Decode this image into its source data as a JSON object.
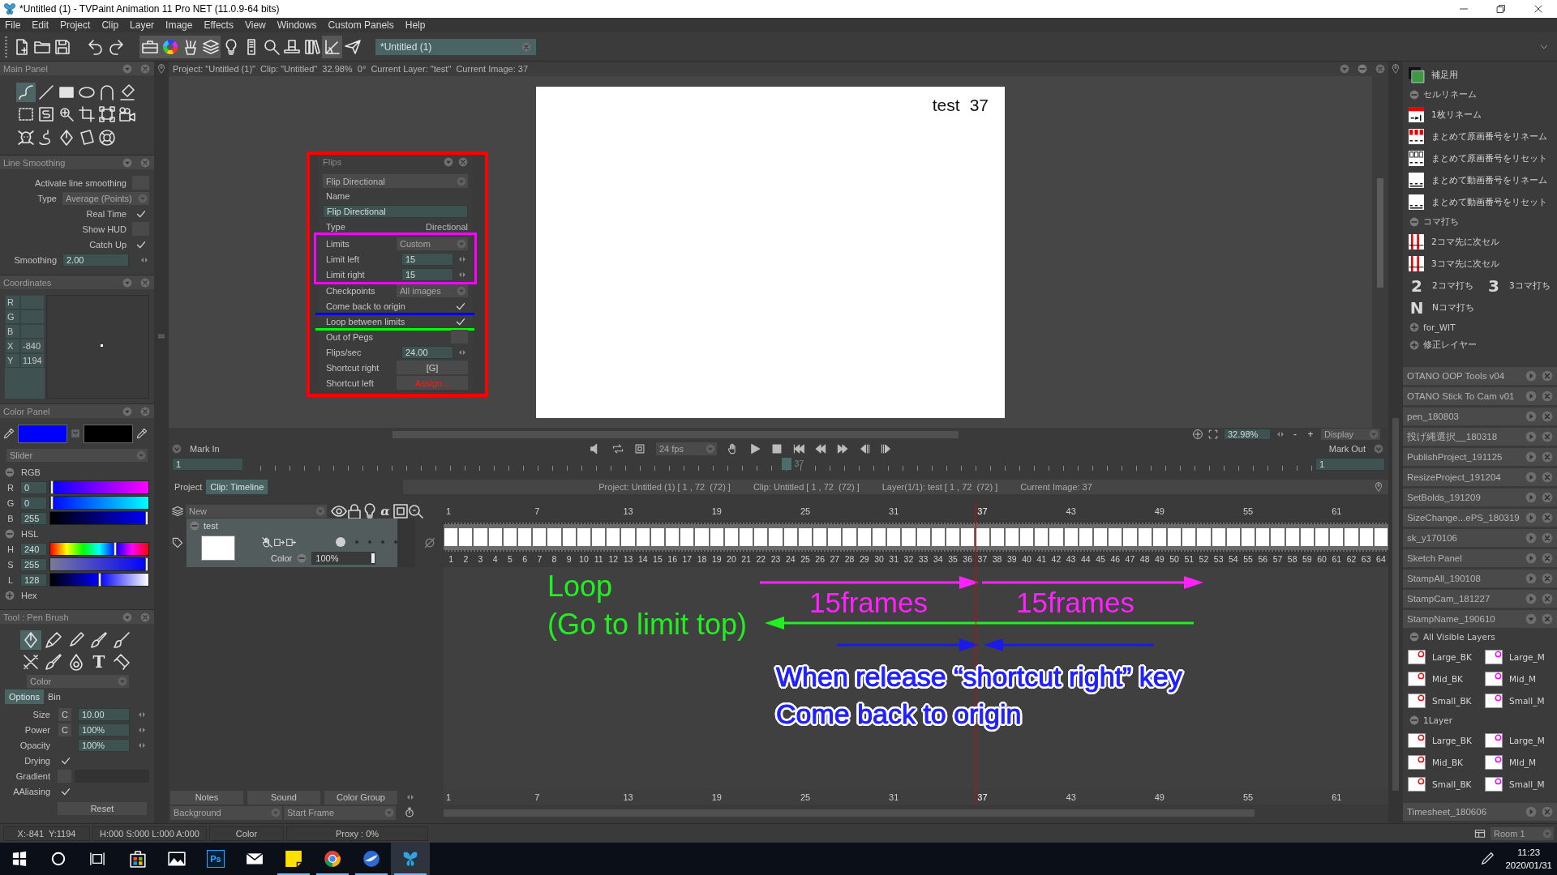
{
  "window": {
    "title": "*Untitled (1) - TVPaint Animation 11 Pro NET (11.0.9-64 bits)"
  },
  "menu": [
    "File",
    "Edit",
    "Project",
    "Clip",
    "Layer",
    "Image",
    "Effects",
    "View",
    "Windows",
    "Custom Panels",
    "Help"
  ],
  "toolbar": {
    "groups": [
      [
        {
          "kind": "newfile",
          "on": false
        },
        {
          "kind": "folder",
          "on": false
        },
        {
          "kind": "floppy",
          "on": false
        }
      ],
      [
        {
          "kind": "undo",
          "on": false
        },
        {
          "kind": "redo",
          "on": false
        }
      ],
      [
        {
          "kind": "toolbox",
          "on": true
        },
        {
          "kind": "colorwheel",
          "on": true
        },
        {
          "kind": "brushcup",
          "on": true
        },
        {
          "kind": "layers",
          "on": true
        },
        {
          "kind": "bulb",
          "on": false
        },
        {
          "kind": "remote",
          "on": false
        },
        {
          "kind": "search",
          "on": false
        },
        {
          "kind": "tophat",
          "on": false
        },
        {
          "kind": "books",
          "on": false
        },
        {
          "kind": "angle",
          "on": true
        },
        {
          "kind": "plane",
          "on": false
        }
      ]
    ],
    "document_tab": "*Untitled (1)"
  },
  "left_panels": {
    "main_panel": {
      "title": "Main Panel",
      "tool_rows": [
        [
          {
            "kind": "freehand",
            "selected": true
          },
          {
            "kind": "line",
            "selected": false
          },
          {
            "kind": "rect",
            "selected": false
          },
          {
            "kind": "ellipse",
            "selected": false
          },
          {
            "kind": "arch",
            "selected": false
          },
          {
            "kind": "eraser",
            "selected": false
          }
        ],
        [
          {
            "kind": "selrect",
            "selected": false
          },
          {
            "kind": "sels",
            "selected": false
          },
          {
            "kind": "zoomplus",
            "selected": false
          },
          {
            "kind": "crop",
            "selected": false
          },
          {
            "kind": "transform",
            "selected": false
          },
          {
            "kind": "camera",
            "selected": false
          }
        ],
        [
          {
            "kind": "skull",
            "selected": false
          },
          {
            "kind": "spring",
            "selected": false
          },
          {
            "kind": "nib",
            "selected": false
          },
          {
            "kind": "paper",
            "selected": false
          },
          {
            "kind": "lifebuoy",
            "selected": false
          }
        ]
      ]
    },
    "line_smoothing": {
      "title": "Line Smoothing",
      "rows": [
        {
          "kind": "check",
          "label": "Activate line smoothing",
          "checked": false
        },
        {
          "kind": "dropdown",
          "label": "Type",
          "value": "Average (Points)"
        },
        {
          "kind": "check",
          "label": "Real Time",
          "checked": true
        },
        {
          "kind": "check",
          "label": "Show HUD",
          "checked": false
        },
        {
          "kind": "check",
          "label": "Catch Up",
          "checked": true
        },
        {
          "kind": "spin",
          "label": "Smoothing",
          "value": "2.00"
        }
      ]
    },
    "coordinates": {
      "title": "Coordinates",
      "rows": [
        {
          "label": "R"
        },
        {
          "label": "G"
        },
        {
          "label": "B"
        },
        {
          "label": "X",
          "value": "-840"
        },
        {
          "label": "Y",
          "value": "1194"
        }
      ]
    },
    "color_panel": {
      "title": "Color Panel",
      "swatches": [
        {
          "color": "#0000ff"
        },
        {
          "color": "#000000"
        }
      ],
      "mode": "Slider",
      "groups": [
        {
          "label": "RGB",
          "expanded": true,
          "sliders": [
            {
              "kind": "red",
              "label": "R",
              "value": "0",
              "level": 0
            },
            {
              "kind": "green",
              "label": "G",
              "value": "0",
              "level": 0
            },
            {
              "kind": "blue",
              "label": "B",
              "value": "255",
              "level": 1
            }
          ]
        },
        {
          "label": "HSL",
          "expanded": true,
          "sliders": [
            {
              "kind": "hue",
              "label": "H",
              "value": "240",
              "level": 0.667
            },
            {
              "kind": "saturation",
              "label": "S",
              "value": "255",
              "level": 1
            },
            {
              "kind": "lightness",
              "label": "L",
              "value": "128",
              "level": 0.5
            }
          ]
        },
        {
          "label": "Hex",
          "expanded": false
        }
      ]
    },
    "pen_brush": {
      "title": "Tool : Pen Brush",
      "tool_rows": [
        [
          {
            "kind": "nib",
            "selected": true
          },
          {
            "kind": "marker",
            "selected": false
          },
          {
            "kind": "crayon",
            "selected": false
          },
          {
            "kind": "brush",
            "selected": false
          },
          {
            "kind": "dipbrush",
            "selected": false
          }
        ],
        [
          {
            "kind": "pencilx",
            "selected": false
          },
          {
            "kind": "brush",
            "selected": false
          },
          {
            "kind": "drop",
            "selected": false
          },
          {
            "kind": "glyph",
            "glyph": "T",
            "selected": false
          },
          {
            "kind": "tube",
            "selected": false
          }
        ]
      ],
      "mode": "Color",
      "tabs": [
        {
          "label": "Options",
          "selected": true
        },
        {
          "label": "Bin",
          "selected": false
        }
      ],
      "rows": [
        {
          "kind": "spin",
          "label": "Size",
          "toggle": "C",
          "value": "10.00"
        },
        {
          "kind": "spin",
          "label": "Power",
          "toggle": "C",
          "value": "100%"
        },
        {
          "kind": "spin",
          "label": "Opacity",
          "value": "100%"
        },
        {
          "kind": "check",
          "label": "Drying",
          "checked": true
        },
        {
          "kind": "gradient",
          "label": "Gradient"
        },
        {
          "kind": "check",
          "label": "AAliasing",
          "checked": true
        }
      ],
      "reset": "Reset"
    }
  },
  "view": {
    "info": "Project: \"Untitled (1)\"  Clip: \"Untitled\"  32.98%  0°  Current Layer: \"test\"  Current Image: 37",
    "canvas": {
      "layer": "test",
      "frame": "37"
    },
    "zoom": "32.98%",
    "zoom_out": "-",
    "zoom_in": "+",
    "display": "Display"
  },
  "flips": {
    "title": "Flips",
    "preset": "Flip Directional",
    "rows": [
      {
        "kind": "label",
        "label": "Name"
      },
      {
        "kind": "field",
        "value": "Flip Directional"
      },
      {
        "kind": "info",
        "label": "Type",
        "value": "Directional"
      },
      {
        "kind": "group",
        "color": "#ff00ff",
        "rows": [
          {
            "kind": "dropdown",
            "label": "Limits",
            "value": "Custom"
          },
          {
            "kind": "spin",
            "label": "Limit left",
            "value": "15"
          },
          {
            "kind": "spin",
            "label": "Limit right",
            "value": "15"
          }
        ]
      },
      {
        "kind": "dropdown",
        "label": "Checkpoints",
        "value": "All images"
      },
      {
        "kind": "check",
        "label": "Come back to origin",
        "checked": true,
        "color": "#0000ff"
      },
      {
        "kind": "check",
        "label": "Loop between limits",
        "checked": true,
        "color": "#00ff00"
      },
      {
        "kind": "check",
        "label": "Out of Pegs",
        "checked": false
      },
      {
        "kind": "spin",
        "label": "Flips/sec",
        "value": "24.00"
      },
      {
        "kind": "button",
        "label": "Shortcut right",
        "value": "[G]",
        "unassigned": false
      },
      {
        "kind": "button",
        "label": "Shortcut left",
        "value": "Assign...",
        "unassigned": true
      }
    ]
  },
  "timeline": {
    "mark_in": "Mark In",
    "mark_out": "Mark Out",
    "transport_left": [
      {
        "kind": "speaker"
      },
      {
        "kind": "loop"
      },
      {
        "kind": "frame"
      }
    ],
    "fps": "24 fps",
    "transport": [
      {
        "kind": "hand"
      },
      {
        "kind": "play"
      },
      {
        "kind": "stop"
      },
      {
        "kind": "first"
      },
      {
        "kind": "rewind"
      },
      {
        "kind": "forward"
      },
      {
        "kind": "stepback"
      },
      {
        "kind": "stepfwd"
      }
    ],
    "scrubber": {
      "start": "1",
      "end": "1",
      "current": "37",
      "level": 0.507
    },
    "tabs": [
      {
        "label": "Project",
        "selected": false
      },
      {
        "label": "Clip: Timeline",
        "selected": true
      }
    ],
    "info": [
      "Project: Untitled (1) [ 1 , 72  (72) ]",
      "Clip: Untitled [ 1 , 72  (72) ]",
      "Layer(1/1): test [ 1 , 72  (72) ]",
      "Current Image: 37"
    ],
    "layer_menu": "New",
    "layer_tools": [
      {
        "kind": "eye"
      },
      {
        "kind": "lock"
      },
      {
        "kind": "bulb"
      },
      {
        "kind": "glyph",
        "glyph": "α"
      },
      {
        "kind": "selbox"
      },
      {
        "kind": "onion"
      }
    ],
    "ruler": [
      {
        "label": "1",
        "selected": false
      },
      {
        "label": "7",
        "selected": false
      },
      {
        "label": "13",
        "selected": false
      },
      {
        "label": "19",
        "selected": false
      },
      {
        "label": "25",
        "selected": false
      },
      {
        "label": "31",
        "selected": false
      },
      {
        "label": "37",
        "selected": true
      },
      {
        "label": "43",
        "selected": false
      },
      {
        "label": "49",
        "selected": false
      },
      {
        "label": "55",
        "selected": false
      },
      {
        "label": "61",
        "selected": false
      }
    ],
    "layer": {
      "name": "test",
      "expanded": true,
      "blend": "Color",
      "opacity": "100%",
      "level": 1
    },
    "frames": [
      "1",
      "2",
      "3",
      "4",
      "5",
      "6",
      "7",
      "8",
      "9",
      "10",
      "11",
      "12",
      "13",
      "14",
      "15",
      "16",
      "17",
      "18",
      "19",
      "20",
      "21",
      "22",
      "23",
      "24",
      "25",
      "26",
      "27",
      "28",
      "29",
      "30",
      "31",
      "32",
      "33",
      "34",
      "35",
      "36",
      "37",
      "38",
      "39",
      "40",
      "41",
      "42",
      "43",
      "44",
      "45",
      "46",
      "47",
      "48",
      "49",
      "50",
      "51",
      "52",
      "53",
      "54",
      "55",
      "56",
      "57",
      "58",
      "59",
      "60",
      "61",
      "62",
      "63",
      "64"
    ],
    "bottom_buttons": [
      "Notes",
      "Sound",
      "Color Group"
    ],
    "bottom_menus": [
      "Background",
      "Start Frame"
    ],
    "bottom_ruler": [
      {
        "label": "1",
        "selected": false
      },
      {
        "label": "7",
        "selected": false
      },
      {
        "label": "13",
        "selected": false
      },
      {
        "label": "19",
        "selected": false
      },
      {
        "label": "25",
        "selected": false
      },
      {
        "label": "31",
        "selected": false
      },
      {
        "label": "37",
        "selected": true
      },
      {
        "label": "43",
        "selected": false
      },
      {
        "label": "49",
        "selected": false
      },
      {
        "label": "55",
        "selected": false
      },
      {
        "label": "61",
        "selected": false
      }
    ]
  },
  "annotations": {
    "loop": [
      "Loop",
      "(Go to limit top)"
    ],
    "spans": [
      "15frames",
      "15frames"
    ],
    "release": [
      "When release “shortcut right” key",
      "Come back to origin"
    ]
  },
  "right_dock": {
    "items": [
      {
        "kind": "layer",
        "label": "補足用"
      },
      {
        "kind": "group",
        "label": "セルリネーム",
        "expanded": true,
        "children": [
          {
            "kind": "rename",
            "label": "1枚リネーム"
          },
          {
            "kind": "redgrid",
            "label": "まとめて原画番号をリネーム"
          },
          {
            "kind": "grid",
            "label": "まとめて原画番号をリセット"
          },
          {
            "kind": "numbers",
            "label": "まとめて動画番号をリネーム"
          },
          {
            "kind": "numbers",
            "label": "まとめて動画番号をリセット"
          }
        ]
      },
      {
        "kind": "group",
        "label": "コマ打ち",
        "expanded": true,
        "children": [
          {
            "kind": "sheet",
            "label": "2コマ先に次セル"
          },
          {
            "kind": "sheet",
            "label": "3コマ先に次セル"
          },
          {
            "kind": "glyph",
            "glyph": "2",
            "label": "2コマ打ち"
          },
          {
            "kind": "glyph",
            "glyph": "3",
            "label": "3コマ打ち"
          },
          {
            "kind": "glyph",
            "glyph": "N",
            "label": "Nコマ打ち"
          }
        ]
      },
      {
        "kind": "group",
        "label": "for_WIT",
        "expanded": false
      },
      {
        "kind": "group",
        "label": "修正レイヤー",
        "expanded": false
      }
    ],
    "panels": [
      {
        "title": "OTANO OOP Tools v04",
        "expanded": false
      },
      {
        "title": "OTANO Stick To Cam v01",
        "expanded": false
      },
      {
        "title": "pen_180803",
        "expanded": false
      },
      {
        "title": "投げ縄選択__180318",
        "expanded": false
      },
      {
        "title": "PublishProject_191125",
        "expanded": false
      },
      {
        "title": "ResizeProject_191204",
        "expanded": false
      },
      {
        "title": "SetBolds_191209",
        "expanded": false
      },
      {
        "title": "SizeChange...ePS_180319",
        "expanded": false
      },
      {
        "title": "sk_y170106",
        "expanded": false
      },
      {
        "title": "Sketch Panel",
        "expanded": false
      },
      {
        "title": "StampAll_190108",
        "expanded": false
      },
      {
        "title": "StampCam_181227",
        "expanded": false
      },
      {
        "title": "StampName_190610",
        "expanded": true,
        "items": [
          {
            "kind": "group",
            "label": "All Visible Layers",
            "expanded": true,
            "children": [
              {
                "kind": "stamp",
                "label": "Large_BK",
                "color": "#e01010"
              },
              {
                "kind": "stamp",
                "label": "Large_M",
                "color": "#ff00ff"
              },
              {
                "kind": "stamp",
                "label": "Mid_BK",
                "color": "#e01010"
              },
              {
                "kind": "stamp",
                "label": "Mid_M",
                "color": "#ff00ff"
              },
              {
                "kind": "stamp",
                "label": "Small_BK",
                "color": "#e01010"
              },
              {
                "kind": "stamp",
                "label": "Small_M",
                "color": "#ff00ff"
              }
            ]
          },
          {
            "kind": "group",
            "label": "1Layer",
            "expanded": true,
            "children": [
              {
                "kind": "stamp",
                "label": "Large_BK",
                "color": "#e01010"
              },
              {
                "kind": "stamp",
                "label": "Large_M",
                "color": "#ff00ff"
              },
              {
                "kind": "stamp",
                "label": "Mid_BK",
                "color": "#e01010"
              },
              {
                "kind": "stamp",
                "label": "MId_M",
                "color": "#ff00ff"
              },
              {
                "kind": "stamp",
                "label": "Small_BK",
                "color": "#e01010"
              },
              {
                "kind": "stamp",
                "label": "Small_M",
                "color": "#ff00ff"
              }
            ]
          }
        ]
      },
      {
        "title": "Timesheet_180606",
        "expanded": false
      }
    ]
  },
  "status_bar": {
    "cells": [
      "X:-841  Y:1194",
      "H:000 S:000 L:000 A:000",
      "Color",
      "Proxy : 0%"
    ],
    "room": "Room 1"
  },
  "taskbar": {
    "system": [
      {
        "kind": "start"
      },
      {
        "kind": "ring"
      },
      {
        "kind": "taskview"
      }
    ],
    "apps": [
      {
        "kind": "store",
        "running": false,
        "active": false
      },
      {
        "kind": "photos",
        "running": false,
        "active": false
      },
      {
        "kind": "glyph",
        "glyph": "Ps",
        "running": false,
        "active": false
      },
      {
        "kind": "mail",
        "running": false,
        "active": false
      },
      {
        "kind": "notes",
        "running": true,
        "active": false
      },
      {
        "kind": "chrome",
        "running": true,
        "active": false
      },
      {
        "kind": "thunderbird",
        "running": true,
        "active": false
      },
      {
        "kind": "butterfly",
        "running": true,
        "active": true
      }
    ],
    "time": "11:23",
    "date": "2020/01/31"
  }
}
